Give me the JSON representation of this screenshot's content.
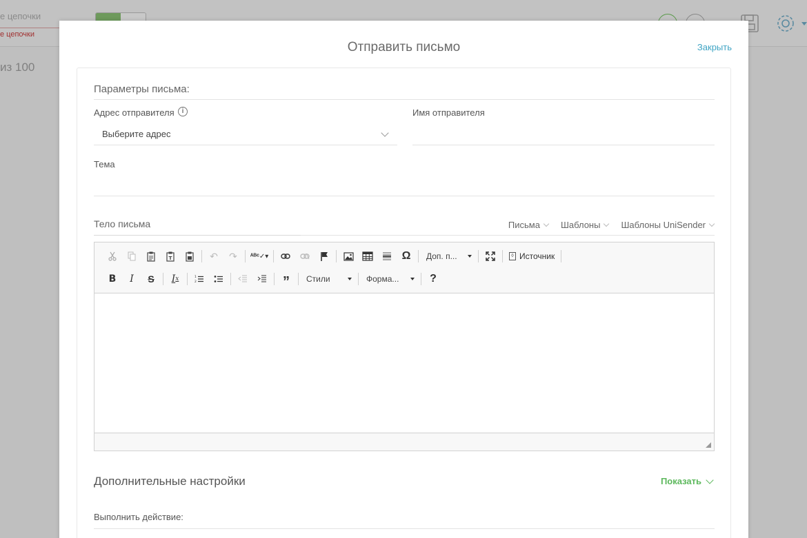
{
  "background": {
    "chain_title": "е цепочки",
    "chain_error": "е цепочки",
    "count_text": "из 100"
  },
  "modal": {
    "title": "Отправить письмо",
    "close_label": "Закрыть"
  },
  "form": {
    "params_title": "Параметры письма:",
    "sender_address_label": "Адрес отправителя",
    "sender_address_value": "Выберите адрес",
    "sender_name_label": "Имя отправителя",
    "sender_name_value": "",
    "subject_label": "Тема",
    "subject_value": "",
    "body_title": "Тело письма",
    "tabs": [
      {
        "label": "Письма"
      },
      {
        "label": "Шаблоны"
      },
      {
        "label": "Шаблоны UniSender"
      }
    ]
  },
  "editor": {
    "more_combo": "Доп. п...",
    "source_label": "Источник",
    "styles_combo": "Стили",
    "format_combo": "Форма...",
    "content": ""
  },
  "advanced": {
    "title": "Дополнительные настройки",
    "show_label": "Показать",
    "action_label": "Выполнить действие:"
  },
  "colors": {
    "accent_link": "#3fa4c4",
    "accent_green": "#5cb85c",
    "overlay": "#bfbfbf"
  }
}
